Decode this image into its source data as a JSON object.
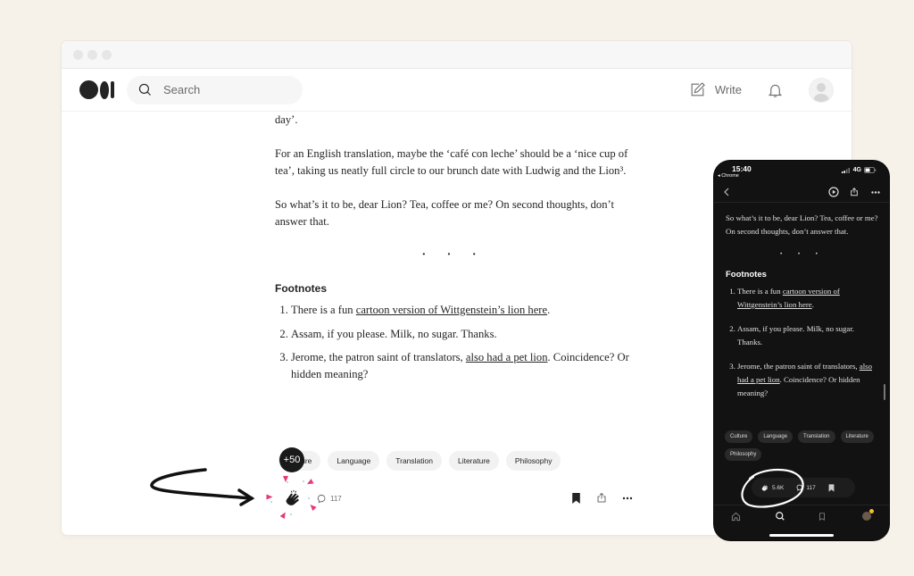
{
  "browser": {
    "search": {
      "placeholder": "Search"
    },
    "nav": {
      "write_label": "Write"
    },
    "article": {
      "para_cut": "work. It doesn’t convey the sense of ‘the warming drink you have to start the day’.",
      "para_translation": "For an English translation, maybe the ‘café con leche’ should be a ‘nice cup of tea’, taking us neatly full circle to our brunch date with Ludwig and the Lion³.",
      "para_question": "So what’s it to be, dear Lion? Tea, coffee or me? On second thoughts, don’t answer that.",
      "separator": "· · ·",
      "footnotes_title": "Footnotes",
      "footnotes": [
        {
          "pre": "There is a fun ",
          "link": "cartoon version of Wittgenstein’s lion here",
          "post": "."
        },
        {
          "pre": "Assam, if you please. Milk, no sugar. Thanks.",
          "link": "",
          "post": ""
        },
        {
          "pre": "Jerome, the patron saint of translators, ",
          "link": "also had a pet lion",
          "post": ". Coincidence? Or hidden meaning?"
        }
      ]
    },
    "tags": [
      "Culture",
      "Language",
      "Translation",
      "Literature",
      "Philosophy"
    ],
    "clap_badge": "+50",
    "responses_count": "117"
  },
  "phone": {
    "status": {
      "time": "15:40",
      "back_app": "◂ Chrome",
      "network": "4G"
    },
    "article": {
      "para_question": "So what’s it to be, dear Lion? Tea, coffee or me? On second thoughts, don’t answer that.",
      "separator": "· · ·",
      "footnotes_title": "Footnotes",
      "footnotes": [
        {
          "pre": "There is a fun ",
          "link": "cartoon version of Wittgenstein’s lion here",
          "post": "."
        },
        {
          "pre": "Assam, if you please. Milk, no sugar. Thanks.",
          "link": "",
          "post": ""
        },
        {
          "pre": "Jerome, the patron saint of translators, ",
          "link": "also had a pet lion",
          "post": ". Coincidence? Or hidden meaning?"
        }
      ]
    },
    "tags": [
      "Culture",
      "Language",
      "Translation",
      "Literature",
      "Philosophy"
    ],
    "claps_count": "5.6K",
    "responses_count": "117"
  },
  "colors": {
    "background": "#f6f1e9",
    "text": "#242424",
    "burst": "#e6397a",
    "phone_bg": "#121212"
  }
}
